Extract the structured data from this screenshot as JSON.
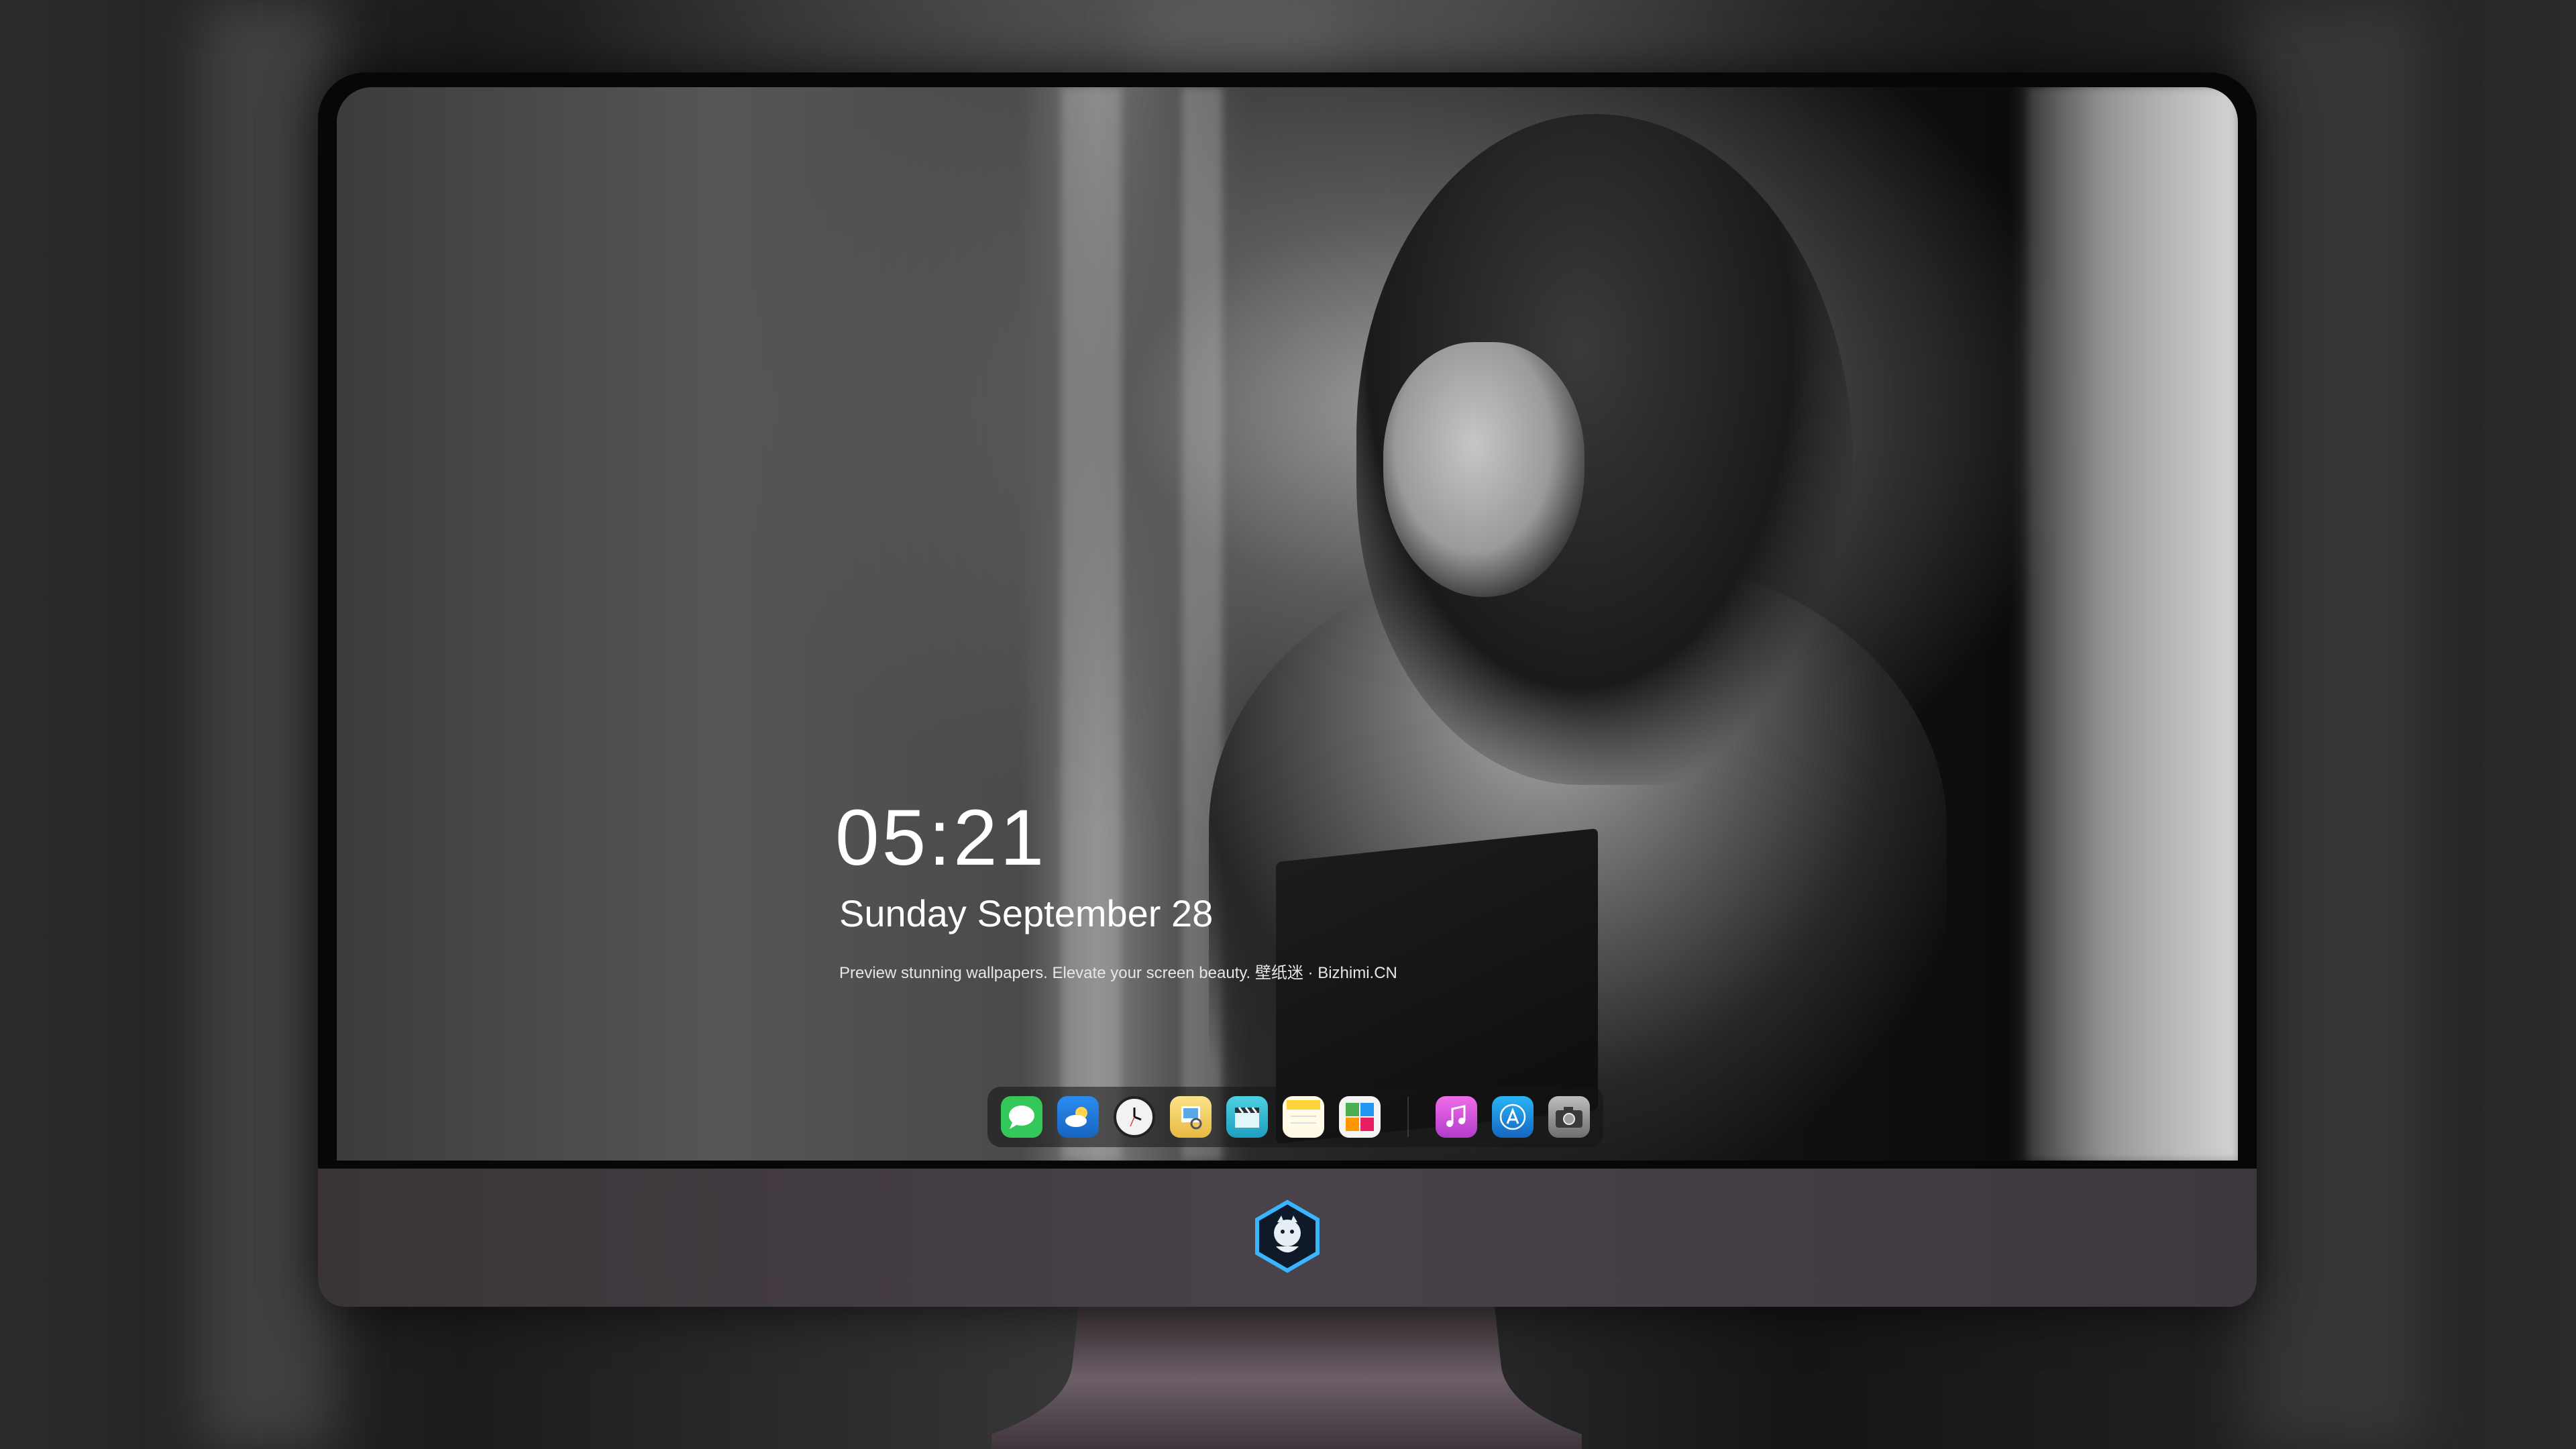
{
  "lockscreen": {
    "time": "05:21",
    "date": "Sunday September  28",
    "tagline": "Preview stunning wallpapers. Elevate your screen beauty. 壁纸迷 · Bizhimi.CN"
  },
  "dock": {
    "apps": [
      {
        "name": "messages-icon",
        "color": "#34c759"
      },
      {
        "name": "weather-icon",
        "color": "#1e88e5"
      },
      {
        "name": "clock-icon",
        "color": "#f2f2f2"
      },
      {
        "name": "preview-icon",
        "color": "#f4d35e"
      },
      {
        "name": "clips-icon",
        "color": "#36c3e0"
      },
      {
        "name": "notes-icon",
        "color": "#ffd43b"
      },
      {
        "name": "photo-booth-icon",
        "color": "#e85d4a"
      },
      {
        "name": "music-icon",
        "color": "#d24bd8"
      },
      {
        "name": "app-store-icon",
        "color": "#1f8fff"
      },
      {
        "name": "camera-icon",
        "color": "#8e8e8e"
      }
    ]
  },
  "colors": {
    "monitor_chin": "#443c44",
    "bezel": "#070707"
  }
}
